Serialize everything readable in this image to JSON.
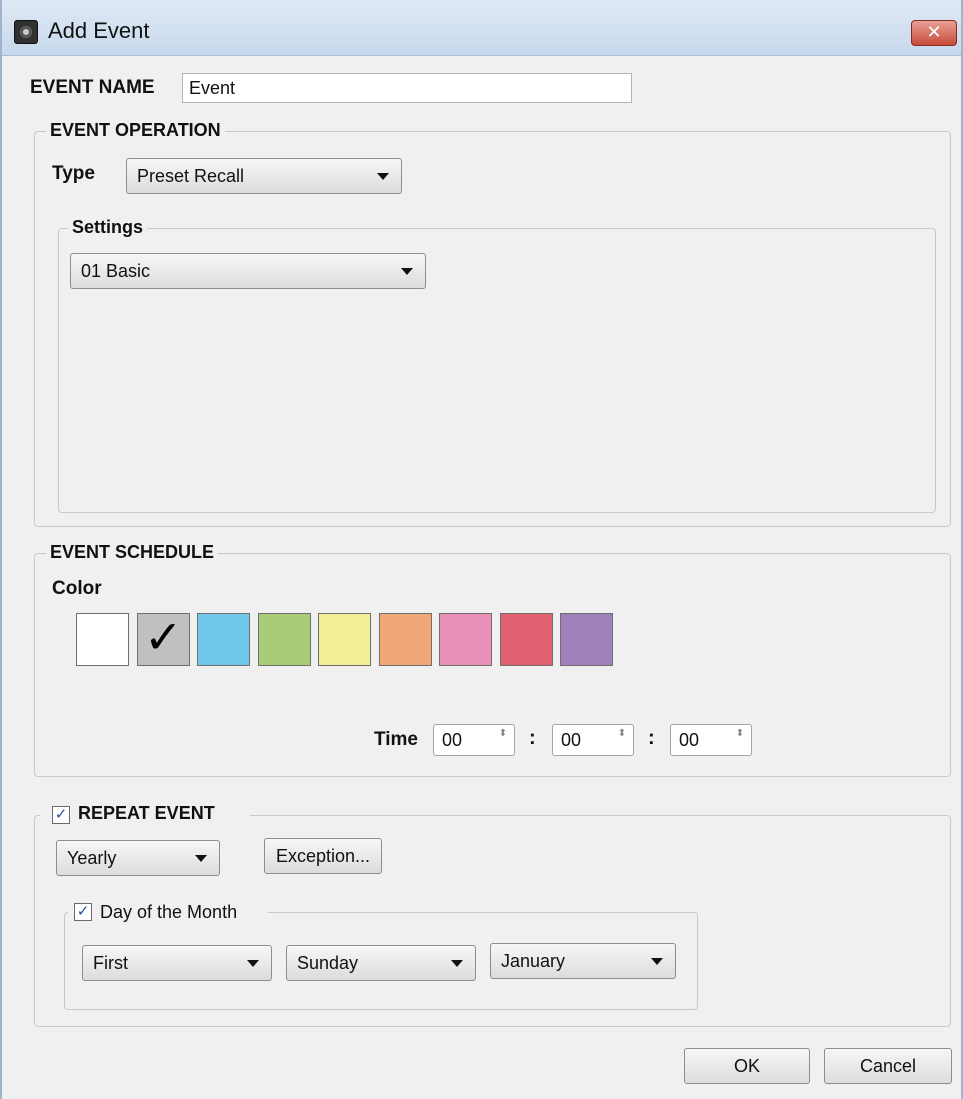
{
  "window": {
    "title": "Add Event",
    "close_label": "✕"
  },
  "event_name": {
    "label": "EVENT NAME",
    "value": "Event"
  },
  "event_operation": {
    "title": "EVENT OPERATION",
    "type_label": "Type",
    "type_value": "Preset Recall",
    "settings_title": "Settings",
    "settings_value": "01 Basic"
  },
  "event_schedule": {
    "title": "EVENT SCHEDULE",
    "color_label": "Color",
    "colors": [
      "#ffffff",
      "#c0c0c0",
      "#6ec6e8",
      "#a8cc78",
      "#f2ee94",
      "#f0a878",
      "#e890b8",
      "#e06070",
      "#a080b8"
    ],
    "selected_color_index": 1,
    "check_glyph": "✓",
    "time_label": "Time",
    "hours": "00",
    "minutes": "00",
    "seconds": "00",
    "separator": ":"
  },
  "repeat_event": {
    "checked": true,
    "title": "REPEAT EVENT",
    "frequency": "Yearly",
    "exception_label": "Exception...",
    "day_of_month": {
      "checked": true,
      "title": "Day of the Month",
      "ordinal": "First",
      "weekday": "Sunday",
      "month": "January"
    }
  },
  "buttons": {
    "ok": "OK",
    "cancel": "Cancel"
  },
  "check_mark": "✓",
  "spinner_arrows": "⬍"
}
